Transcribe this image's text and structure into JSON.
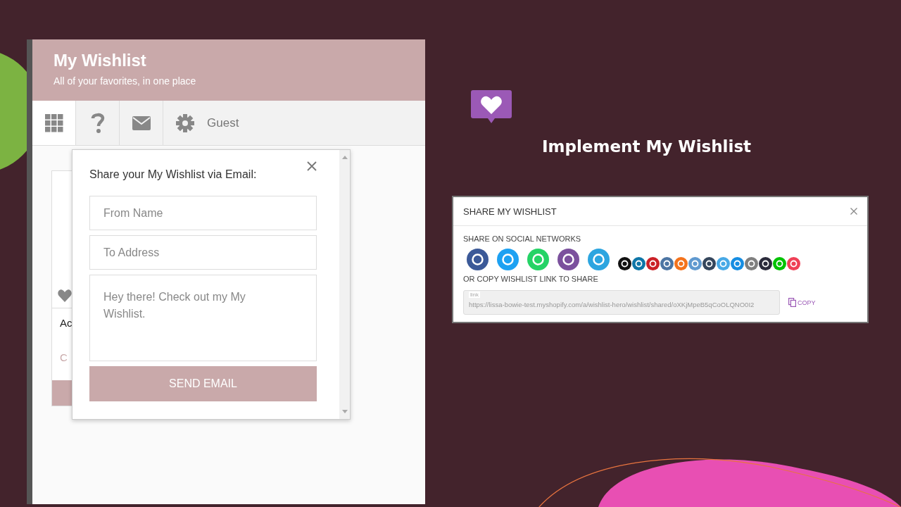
{
  "slide": {
    "title": "Implement My Wishlist"
  },
  "wishlist_panel": {
    "title": "My Wishlist",
    "subtitle": "All of your favorites, in one place",
    "toolbar": [
      {
        "kind": "grid",
        "selected": true
      },
      {
        "kind": "help",
        "selected": false
      },
      {
        "kind": "mail",
        "selected": false
      },
      {
        "kind": "settings",
        "selected": false,
        "label": "Guest"
      }
    ],
    "card": {
      "text_1": "Ac",
      "text_2": "C"
    },
    "email_popup": {
      "title": "Share your My Wishlist via Email:",
      "fields": [
        {
          "placeholder": "From Name"
        },
        {
          "placeholder": "To Address"
        }
      ],
      "message": {
        "placeholder": "Hey there! Check out my My Wishlist."
      },
      "button": "SEND EMAIL"
    }
  },
  "share_dialog": {
    "title": "SHARE MY WISHLIST",
    "social_label": "SHARE ON SOCIAL NETWORKS",
    "networks": [
      {
        "kind": "large",
        "color": "#3b5998"
      },
      {
        "kind": "large",
        "color": "#1da1f2"
      },
      {
        "kind": "large",
        "color": "#25d366"
      },
      {
        "kind": "large",
        "color": "#7b519d"
      },
      {
        "kind": "large",
        "color": "#2ca5e0"
      },
      {
        "kind": "small",
        "color": "#111111"
      },
      {
        "kind": "small",
        "color": "#0e76a8"
      },
      {
        "kind": "small",
        "color": "#cb2027"
      },
      {
        "kind": "small",
        "color": "#4c75a3"
      },
      {
        "kind": "small",
        "color": "#f4731c"
      },
      {
        "kind": "small",
        "color": "#5f99cf"
      },
      {
        "kind": "small",
        "color": "#35465c"
      },
      {
        "kind": "small",
        "color": "#48a9e6"
      },
      {
        "kind": "small",
        "color": "#168de2"
      },
      {
        "kind": "small",
        "color": "#7f7f7f"
      },
      {
        "kind": "small",
        "color": "#2b2b3b"
      },
      {
        "kind": "small",
        "color": "#00c300"
      },
      {
        "kind": "small",
        "color": "#ef4056"
      }
    ],
    "link_label": "OR COPY WISHLIST LINK TO SHARE",
    "link": {
      "label": "link",
      "value": "https://lissa-bowie-test.myshopify.com/a/wishlist-hero/wishlist/shared/oXKjMpeB5qCoOLQNO0I2"
    },
    "copy_button": "COPY"
  }
}
